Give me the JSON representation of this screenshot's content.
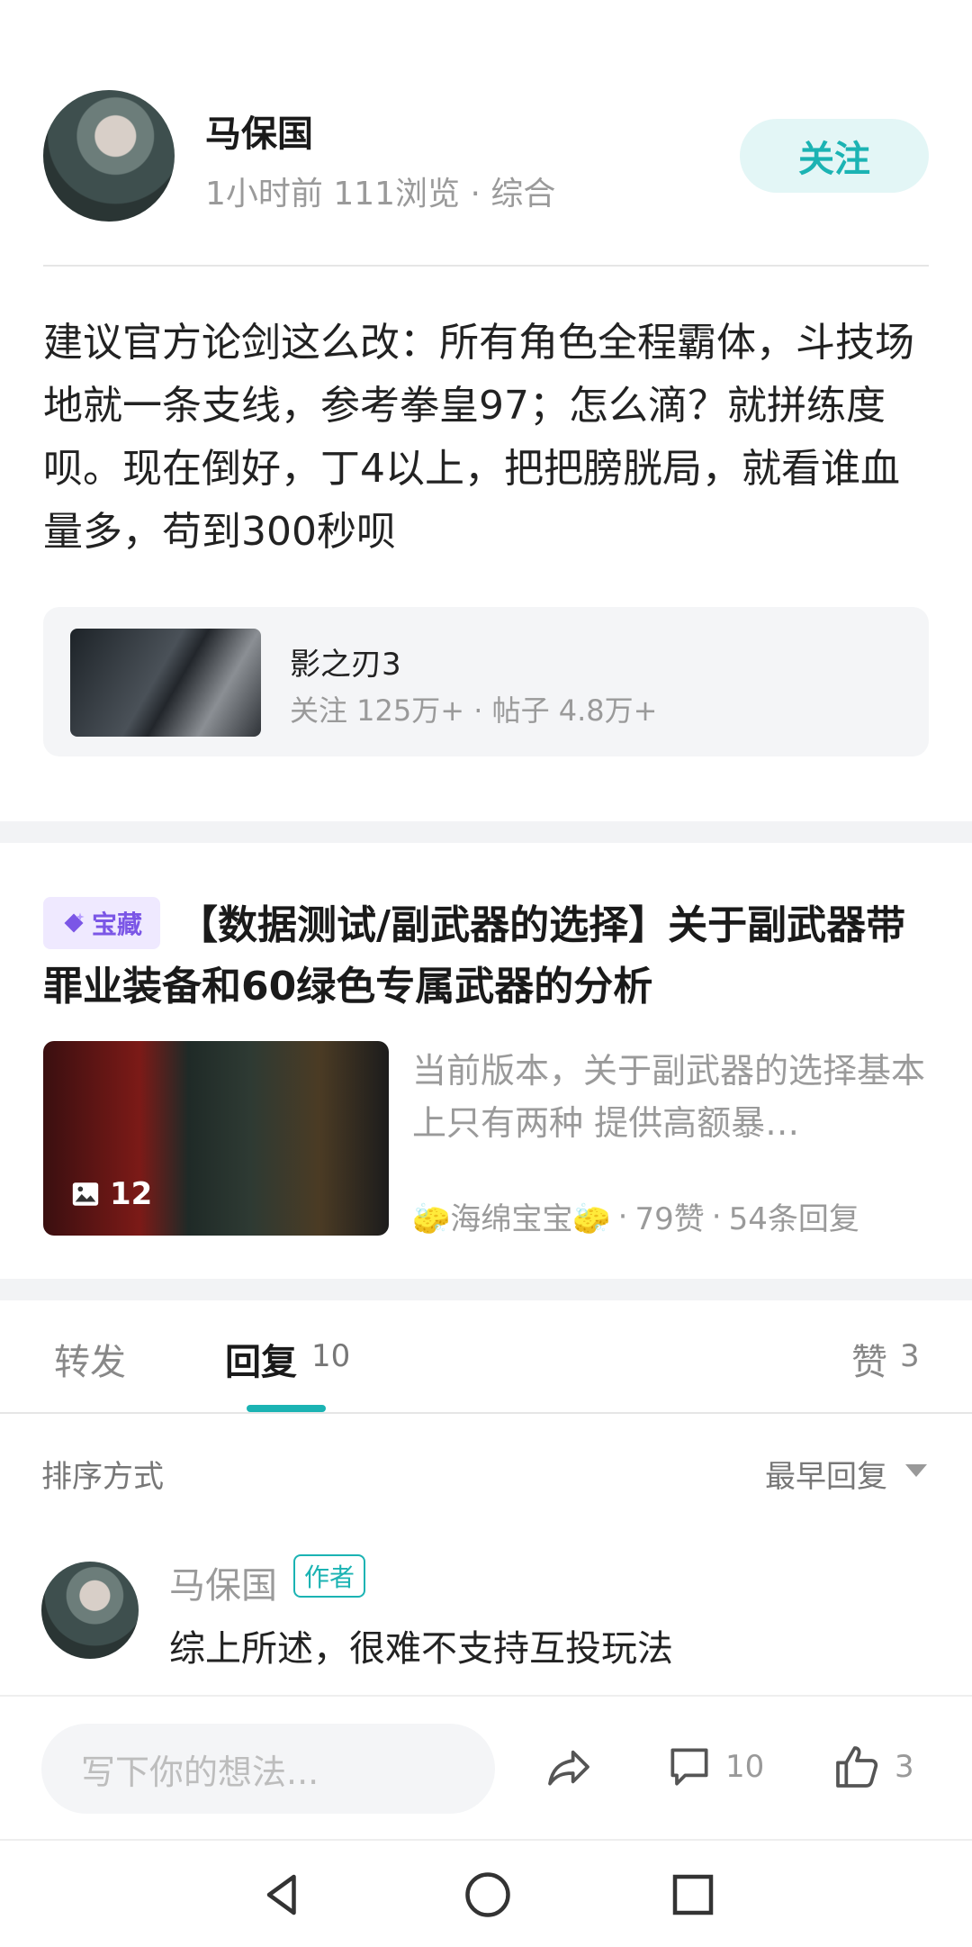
{
  "post": {
    "author_name": "马保国",
    "meta": "1小时前  111浏览  ·  综合",
    "follow_label": "关注",
    "body": "建议官方论剑这么改：所有角色全程霸体，斗技场地就一条支线，参考拳皇97；怎么滴？就拼练度呗。现在倒好，丁4以上，把把膀胱局，就看谁血量多，苟到300秒呗"
  },
  "game_card": {
    "title": "影之刃3",
    "stats": "关注 125万+  ·  帖子 4.8万+"
  },
  "recommended": {
    "badge": "宝藏",
    "title": "【数据测试/副武器的选择】关于副武器带罪业装备和60绿色专属武器的分析",
    "image_count": "12",
    "excerpt": "当前版本，关于副武器的选择基本上只有两种 提供高额暴…",
    "author": "🧽海绵宝宝🧽",
    "likes": "79赞",
    "replies": "54条回复"
  },
  "tabs": {
    "repost": "转发",
    "reply": "回复",
    "reply_count": "10",
    "like": "赞",
    "like_count": "3"
  },
  "sort": {
    "label": "排序方式",
    "value": "最早回复"
  },
  "comment": {
    "name": "马保国",
    "tag": "作者",
    "text": "综上所述，很难不支持互投玩法"
  },
  "bottom": {
    "input_placeholder": "写下你的想法...",
    "reply_count": "10",
    "like_count": "3"
  },
  "icons": [
    "share-icon",
    "comment-icon",
    "thumbs-up-icon",
    "image-icon",
    "diamond-icon",
    "nav-back-icon",
    "nav-home-icon",
    "nav-recent-icon"
  ],
  "colors": {
    "accent": "#1bb3b3",
    "badge_purple": "#7b56e6"
  }
}
